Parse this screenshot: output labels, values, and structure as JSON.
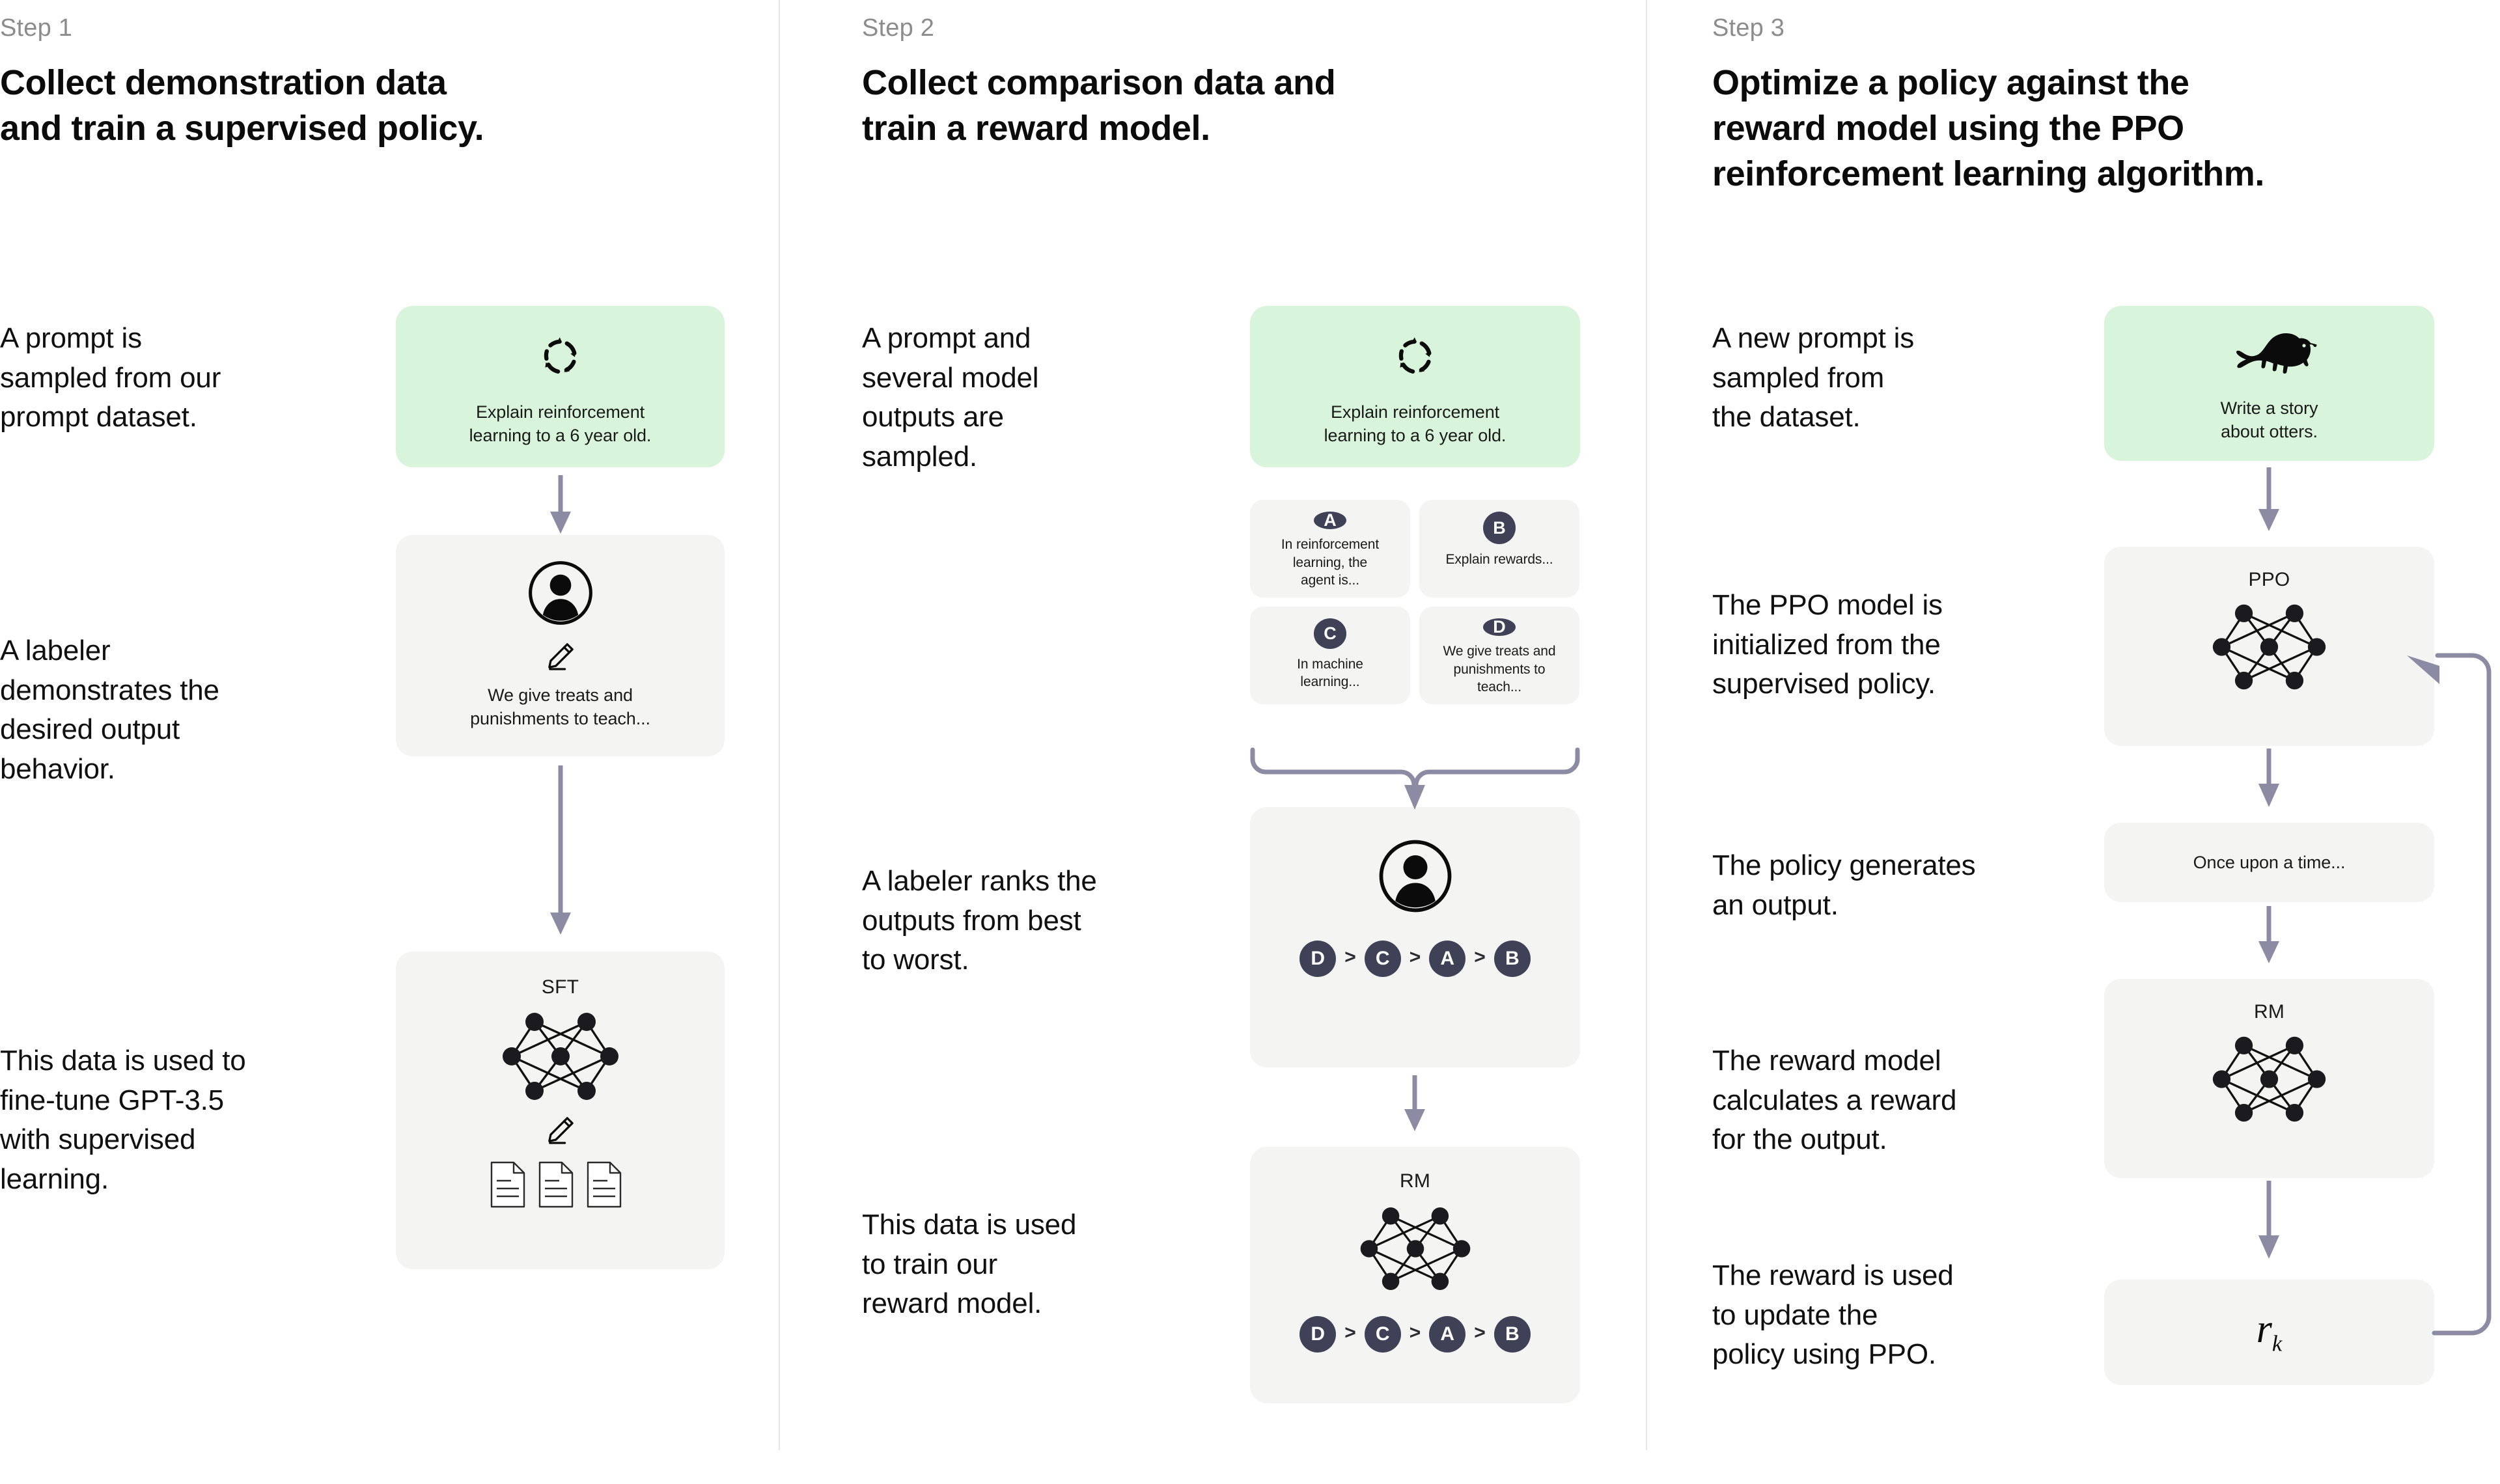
{
  "palette": {
    "background": "#ffffff",
    "prompt_card": "#d8f5db",
    "gray_card": "#f4f4f2",
    "badge": "#3f4257",
    "arrow": "#8b8ca3",
    "divider": "#e6e6e6",
    "step_label": "#8c8c8c"
  },
  "columns": [
    {
      "step_label": "Step 1",
      "title": "Collect demonstration data\nand train a supervised policy.",
      "title_line1": "Collect demonstration data",
      "title_line2": "and train a supervised policy.",
      "descriptions": [
        "A prompt is\nsampled from our\nprompt dataset.",
        "A labeler\ndemonstrates the\ndesired output\nbehavior.",
        "This data is used to\nfine-tune GPT-3.5\nwith supervised\nlearning."
      ],
      "cards": {
        "prompt": {
          "caption": "Explain reinforcement\nlearning to a 6 year old.",
          "icon": "cycle-arrows-icon"
        },
        "demo": {
          "caption": "We give treats and\npunishments to teach...",
          "icons": [
            "labeler-person-icon",
            "pencil-icon"
          ]
        },
        "sft": {
          "title": "SFT",
          "icons": [
            "neural-network-icon",
            "pencil-icon",
            "documents-icon"
          ]
        }
      }
    },
    {
      "step_label": "Step 2",
      "title": "Collect comparison data and\ntrain a reward model.",
      "title_line1": "Collect comparison data and",
      "title_line2": "train a reward model.",
      "descriptions": [
        "A prompt and\nseveral model\noutputs are\nsampled.",
        "A labeler ranks the\noutputs from best\nto worst.",
        "This data is used\nto train our\nreward model."
      ],
      "cards": {
        "prompt": {
          "caption": "Explain reinforcement\nlearning to a 6 year old.",
          "icon": "cycle-arrows-icon"
        },
        "options": [
          {
            "letter": "A",
            "text": "In reinforcement\nlearning, the\nagent is..."
          },
          {
            "letter": "B",
            "text": "Explain rewards..."
          },
          {
            "letter": "C",
            "text": "In machine\nlearning..."
          },
          {
            "letter": "D",
            "text": "We give treats and\npunishments to\nteach..."
          }
        ],
        "ranking": {
          "icon": "labeler-person-icon",
          "order": [
            "D",
            "C",
            "A",
            "B"
          ],
          "separator": ">"
        },
        "rm": {
          "title": "RM",
          "icon": "neural-network-icon",
          "order": [
            "D",
            "C",
            "A",
            "B"
          ],
          "separator": ">"
        }
      }
    },
    {
      "step_label": "Step 3",
      "title": "Optimize a policy against the\nreward model using the PPO\nreinforcement learning algorithm.",
      "title_line1": "Optimize a policy against the",
      "title_line2": "reward model using the PPO",
      "title_line3": "reinforcement learning algorithm.",
      "descriptions": [
        "A new prompt is\nsampled from\nthe dataset.",
        "The PPO model is\ninitialized from the\nsupervised policy.",
        "The policy generates\nan output.",
        "The reward model\ncalculates a reward\nfor the output.",
        "The reward is used\nto update the\npolicy using PPO."
      ],
      "cards": {
        "prompt": {
          "caption": "Write a story\nabout otters.",
          "icon": "otter-icon"
        },
        "ppo": {
          "title": "PPO",
          "icon": "neural-network-icon"
        },
        "output": {
          "caption": "Once upon a time..."
        },
        "rm": {
          "title": "RM",
          "icon": "neural-network-icon"
        },
        "reward": {
          "symbol": "r",
          "subscript": "k"
        }
      }
    }
  ]
}
